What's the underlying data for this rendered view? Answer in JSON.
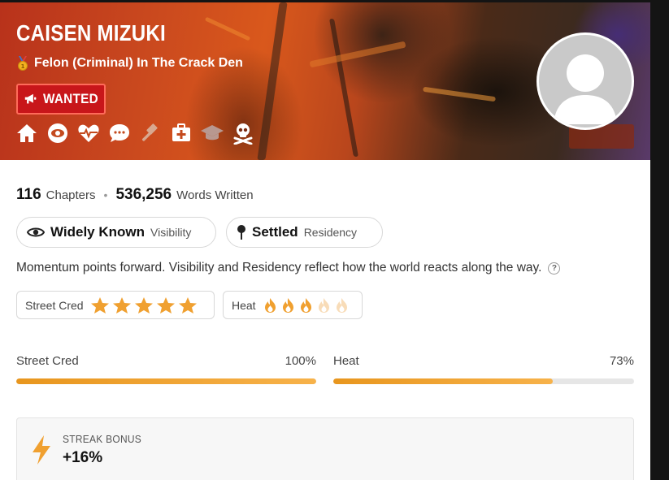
{
  "profile": {
    "name": "CAISEN MIZUKI",
    "rank": "Felon (Criminal) In The Crack Den",
    "status_badge": "WANTED",
    "nav_icons": [
      "home-icon",
      "eye-icon",
      "heart-pulse-icon",
      "chat-icon",
      "gavel-icon",
      "medkit-icon",
      "graduation-cap-icon",
      "skull-crossbones-icon"
    ]
  },
  "stats": {
    "chapters_value": "116",
    "chapters_label": "Chapters",
    "words_value": "536,256",
    "words_label": "Words Written"
  },
  "visibility": {
    "value": "Widely Known",
    "label": "Visibility"
  },
  "residency": {
    "value": "Settled",
    "label": "Residency"
  },
  "note": "Momentum points forward. Visibility and Residency reflect how the world reacts along the way.",
  "help": "?",
  "meters": {
    "street_cred": {
      "label": "Street Cred",
      "stars_filled": 5,
      "stars_total": 5
    },
    "heat": {
      "label": "Heat",
      "flames_filled": 3,
      "flames_total": 5
    }
  },
  "bars": {
    "street_cred": {
      "label": "Street Cred",
      "percent_text": "100%",
      "fraction": 1.0
    },
    "heat": {
      "label": "Heat",
      "percent_text": "73%",
      "fraction": 0.73
    }
  },
  "streak": {
    "label": "STREAK BONUS",
    "value": "+16%"
  },
  "colors": {
    "accent": "#f0a030",
    "wanted": "#c8161a"
  }
}
